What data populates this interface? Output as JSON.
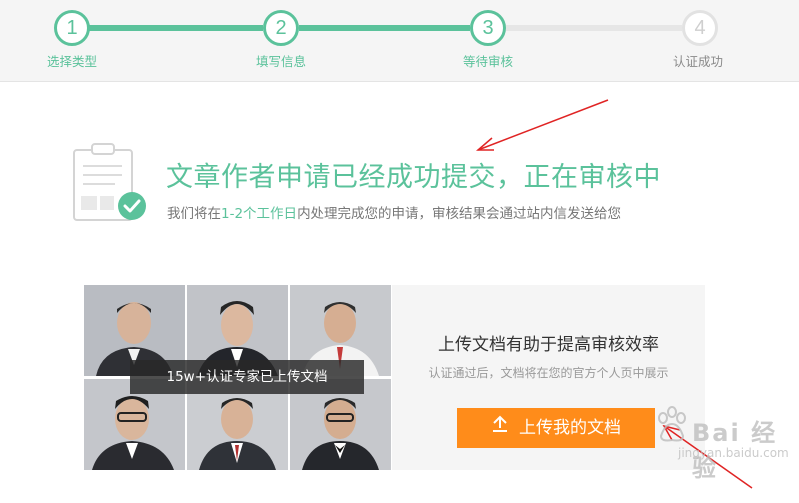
{
  "stepper": {
    "steps": [
      {
        "number": "1",
        "label": "选择类型",
        "state": "done"
      },
      {
        "number": "2",
        "label": "填写信息",
        "state": "done"
      },
      {
        "number": "3",
        "label": "等待审核",
        "state": "current"
      },
      {
        "number": "4",
        "label": "认证成功",
        "state": "todo"
      }
    ],
    "colors": {
      "done": "#5bc29b",
      "todo": "#e2e2e2"
    }
  },
  "success": {
    "icon": "document-check-icon",
    "title": "文章作者申请已经成功提交，正在审核中",
    "desc_prefix": "我们将在",
    "desc_highlight": "1-2个工作日",
    "desc_suffix": "内处理完成您的申请，审核结果会通过站内信发送给您"
  },
  "experts": {
    "caption": "15w+认证专家已上传文档",
    "photo_count": 6
  },
  "upload": {
    "title": "上传文档有助于提高审核效率",
    "subtitle": "认证通过后，文档将在您的官方个人页中展示",
    "button_label": "上传我的文档",
    "button_icon": "upload-arrow-icon",
    "button_color": "#ff8c1a"
  },
  "watermark": {
    "text": "Bai 经验",
    "url": "jingyan.baidu.com"
  }
}
